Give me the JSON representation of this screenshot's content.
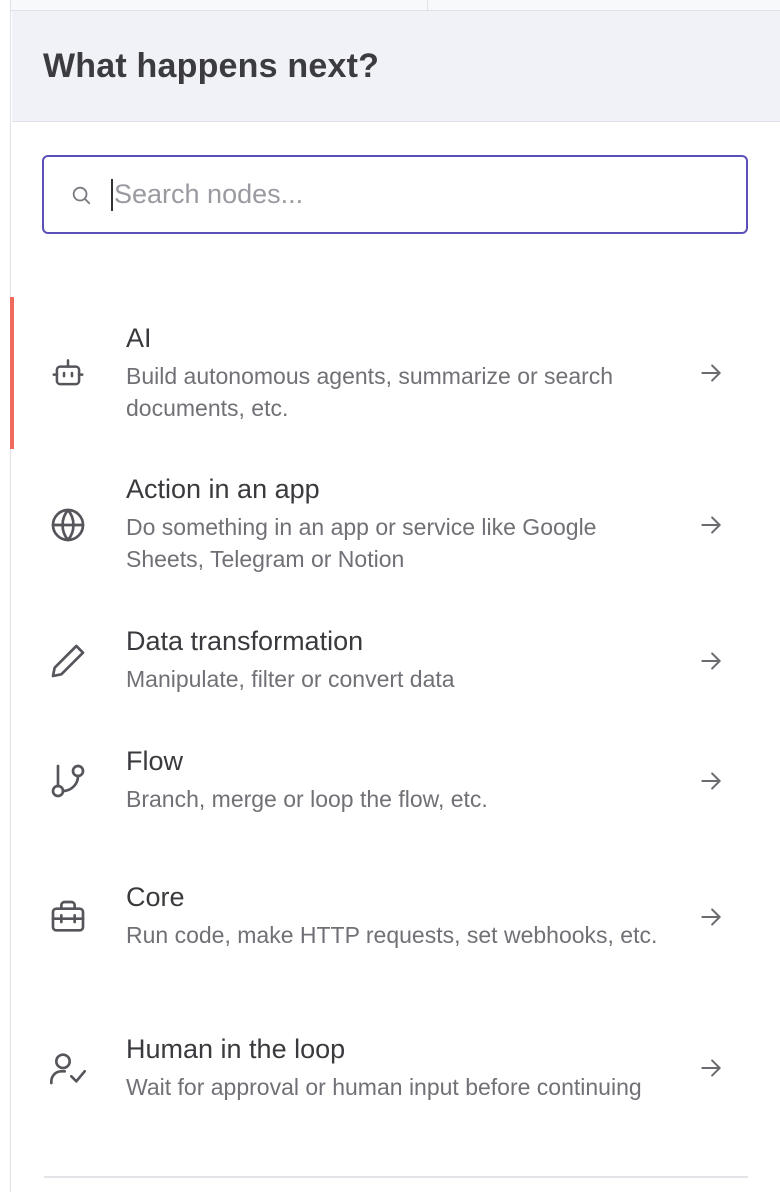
{
  "panel": {
    "title": "What happens next?"
  },
  "search": {
    "placeholder": "Search nodes...",
    "value": "",
    "icon": "search-icon"
  },
  "items": [
    {
      "title": "AI",
      "description": "Build autonomous agents, summarize or search documents, etc.",
      "icon": "robot-icon",
      "active": true
    },
    {
      "title": "Action in an app",
      "description": "Do something in an app or service like Google Sheets, Telegram or Notion",
      "icon": "globe-icon",
      "active": false
    },
    {
      "title": "Data transformation",
      "description": "Manipulate, filter or convert data",
      "icon": "pencil-icon",
      "active": false
    },
    {
      "title": "Flow",
      "description": "Branch, merge or loop the flow, etc.",
      "icon": "git-branch-icon",
      "active": false
    },
    {
      "title": "Core",
      "description": "Run code, make HTTP requests, set webhooks, etc.",
      "icon": "toolbox-icon",
      "active": false
    },
    {
      "title": "Human in the loop",
      "description": "Wait for approval or human input before continuing",
      "icon": "user-check-icon",
      "active": false
    }
  ],
  "colors": {
    "accent": "#ee6b5d",
    "focus_border": "#5b4fb8",
    "header_bg": "#f0f2f7"
  }
}
